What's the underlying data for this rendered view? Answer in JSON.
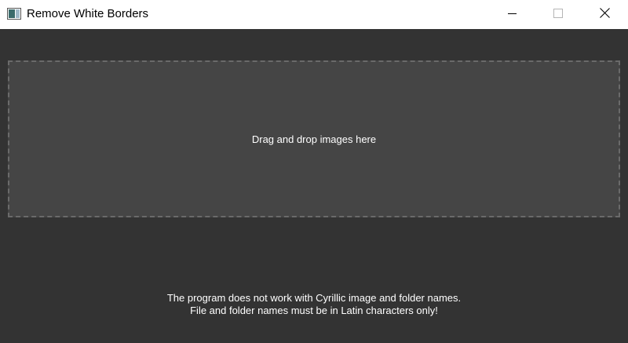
{
  "window": {
    "title": "Remove White Borders",
    "icons": {
      "app": "app-window-icon",
      "minimize": "minimize-icon",
      "maximize": "maximize-icon",
      "close": "close-icon"
    }
  },
  "drop_zone": {
    "label": "Drag and drop images here"
  },
  "notice": {
    "line1": "The program does not work with Cyrillic image and folder names.",
    "line2": "File and folder names must be in Latin characters only!"
  },
  "colors": {
    "background": "#333333",
    "drop_zone_fill": "#454545",
    "drop_zone_border": "#6a6a6a",
    "titlebar": "#ffffff",
    "text": "#ffffff"
  }
}
